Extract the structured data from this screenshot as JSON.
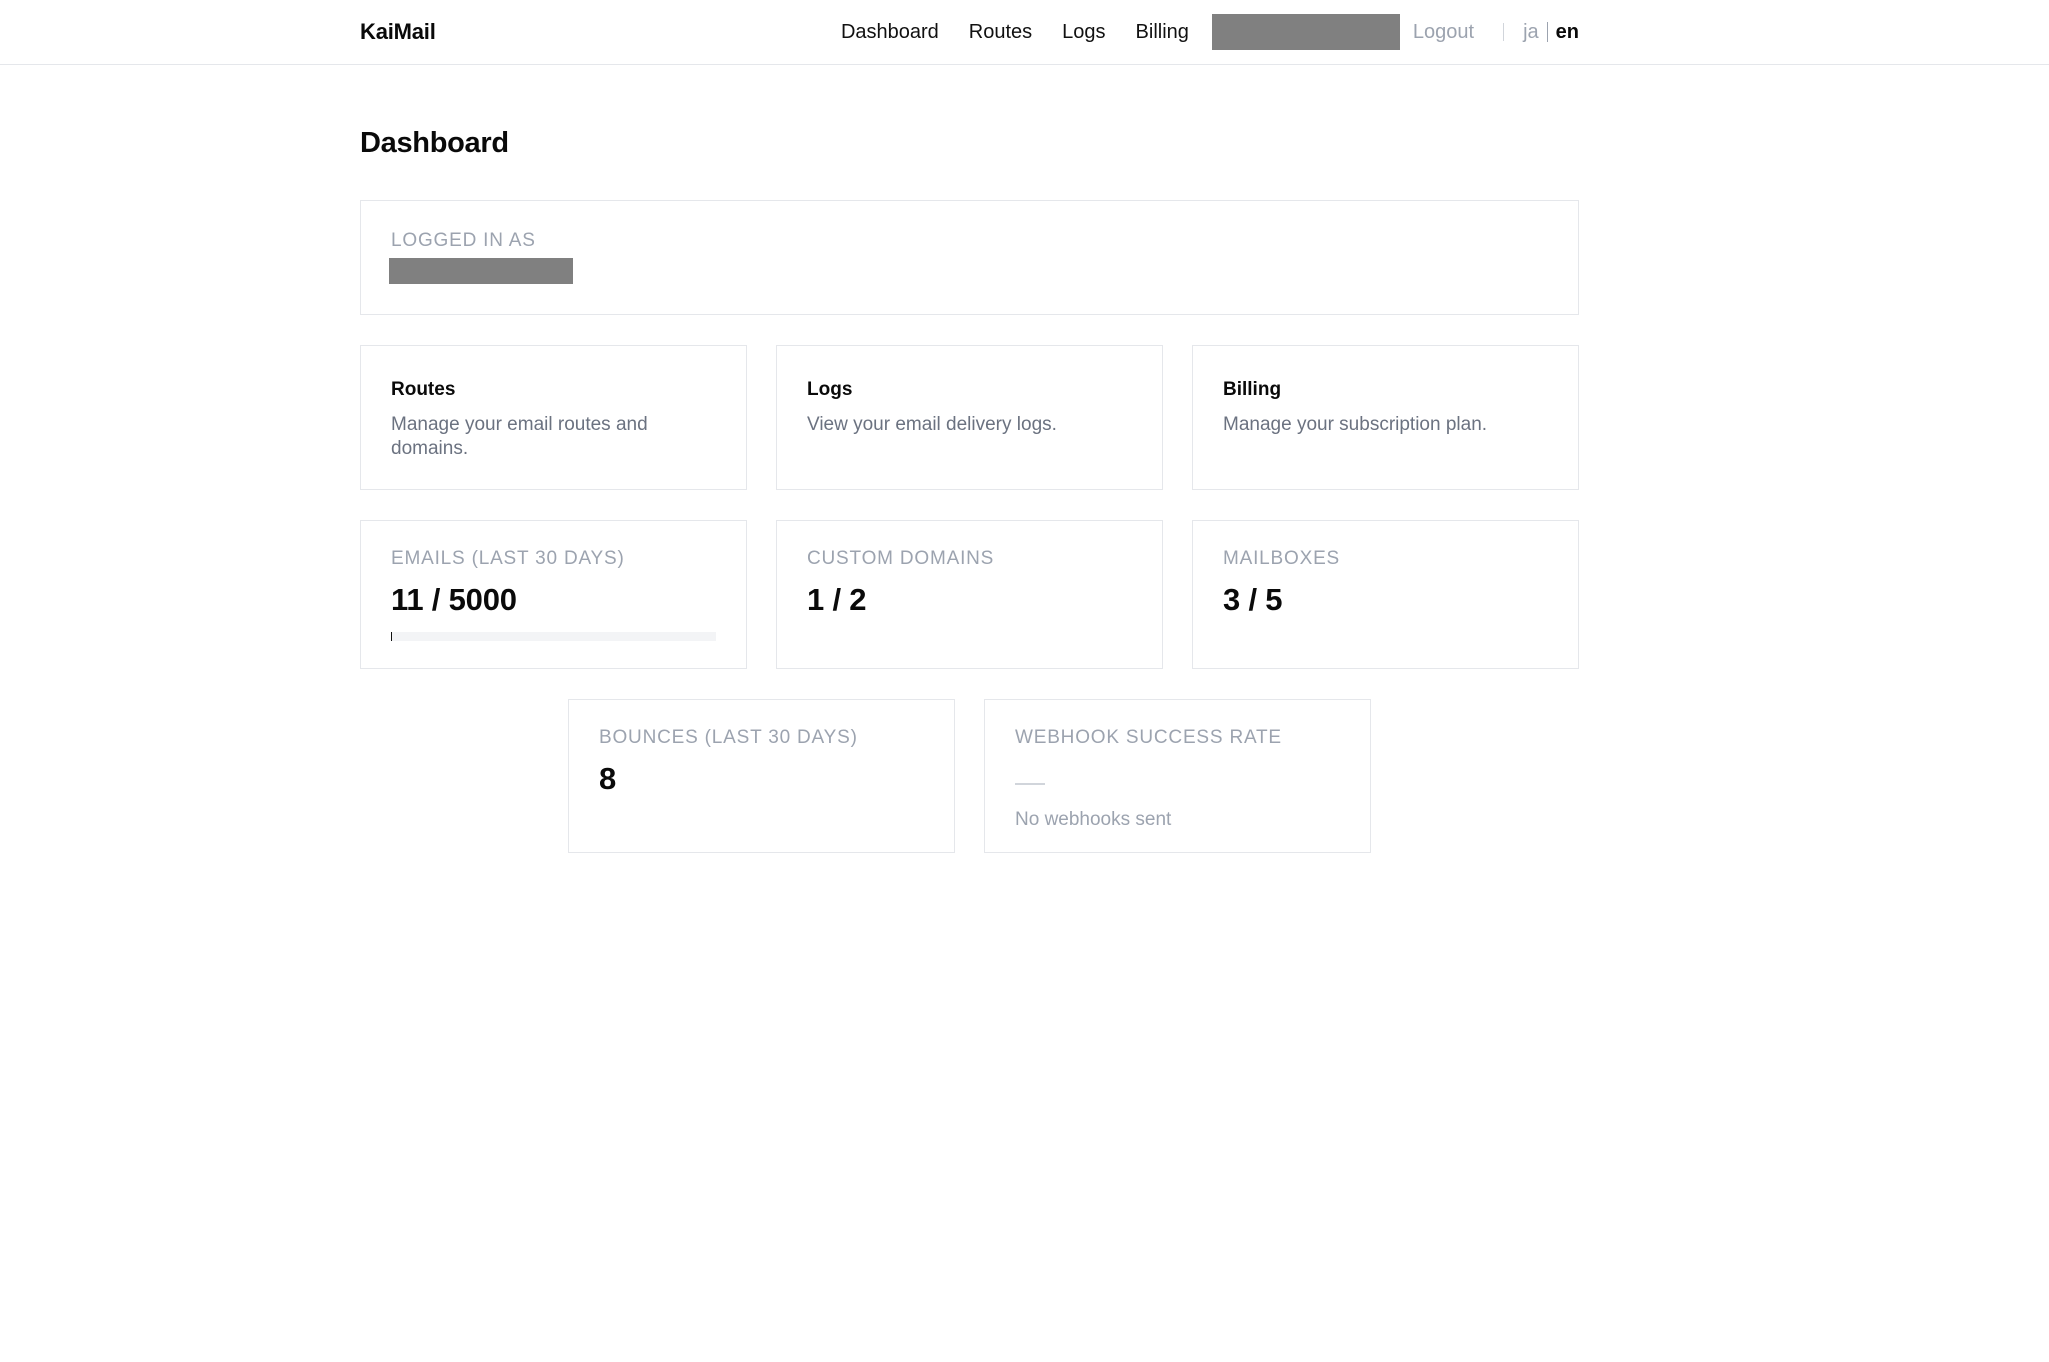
{
  "header": {
    "brand": "KaiMail",
    "nav": [
      "Dashboard",
      "Routes",
      "Logs",
      "Billing"
    ],
    "logout": "Logout",
    "lang": {
      "ja": "ja",
      "en": "en",
      "active": "en"
    }
  },
  "page": {
    "title": "Dashboard"
  },
  "user": {
    "label": "LOGGED IN AS"
  },
  "links": [
    {
      "title": "Routes",
      "description": "Manage your email routes and domains."
    },
    {
      "title": "Logs",
      "description": "View your email delivery logs."
    },
    {
      "title": "Billing",
      "description": "Manage your subscription plan."
    }
  ],
  "stats": {
    "emails": {
      "label": "EMAILS (LAST 30 DAYS)",
      "value": "11 / 5000",
      "used": 11,
      "limit": 5000
    },
    "domains": {
      "label": "CUSTOM DOMAINS",
      "value": "1 / 2"
    },
    "mailboxes": {
      "label": "MAILBOXES",
      "value": "3 / 5"
    },
    "bounces": {
      "label": "BOUNCES (LAST 30 DAYS)",
      "value": "8"
    },
    "webhooks": {
      "label": "WEBHOOK SUCCESS RATE",
      "note": "No webhooks sent"
    }
  },
  "colors": {
    "muted": "#9ca3af",
    "body_text": "#6b7280",
    "border": "#e5e7eb",
    "redacted": "#808080"
  }
}
